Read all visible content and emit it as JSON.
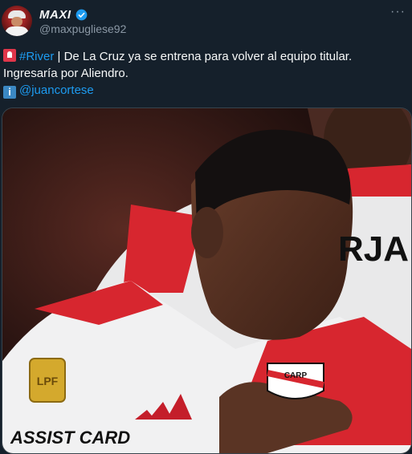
{
  "user": {
    "display_name": "MAXI",
    "handle": "@maxpugliese92"
  },
  "tweet": {
    "hashtag": "#River",
    "text_after_hashtag": " | De La Cruz ya se entrena para volver al equipo titular.",
    "line2": "Ingresaría por Aliendro.",
    "source_mention": "@juancortese",
    "icons": [
      "siren-icon",
      "info-icon",
      "verified-badge-icon",
      "more-options-icon"
    ]
  },
  "media": {
    "jersey_back_text": "RJA",
    "sleeve_sponsor": "ASSIST CARD",
    "crest_text": "CARP",
    "patch_text": "LPF"
  },
  "colors": {
    "background": "#15202b",
    "text": "#f7f9f9",
    "muted": "#8b98a5",
    "link": "#1d9bf0",
    "verified": "#1d9bf0",
    "river_red": "#e4212b"
  }
}
